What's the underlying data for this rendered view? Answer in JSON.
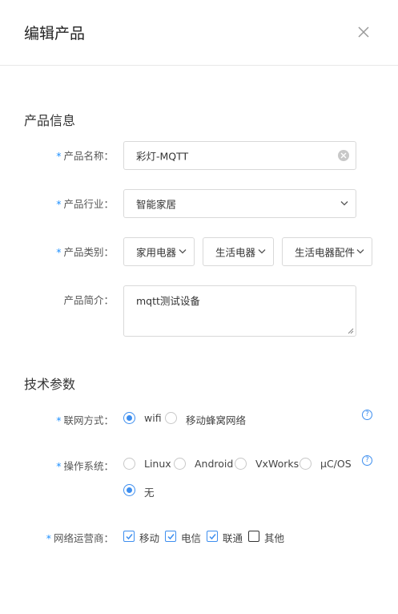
{
  "dialog": {
    "title": "编辑产品",
    "close_icon": "close-icon"
  },
  "product_info": {
    "section_title": "产品信息",
    "name": {
      "label": "产品名称：",
      "value": "彩灯-MQTT",
      "required": true
    },
    "industry": {
      "label": "产品行业：",
      "value": "智能家居",
      "required": true
    },
    "category": {
      "label": "产品类别：",
      "required": true,
      "level1": "家用电器",
      "level2": "生活电器",
      "level3": "生活电器配件"
    },
    "description": {
      "label": "产品简介：",
      "value": "mqtt测试设备",
      "required": false
    }
  },
  "tech_params": {
    "section_title": "技术参数",
    "network": {
      "label": "联网方式：",
      "required": true,
      "options": [
        "wifi",
        "移动蜂窝网络"
      ],
      "selected": "wifi",
      "help": "?"
    },
    "os": {
      "label": "操作系统：",
      "required": true,
      "options": [
        "Linux",
        "Android",
        "VxWorks",
        "μC/OS",
        "无"
      ],
      "selected": "无",
      "help": "?"
    },
    "carrier": {
      "label": "网络运营商：",
      "required": true,
      "options": [
        {
          "label": "移动",
          "checked": true
        },
        {
          "label": "电信",
          "checked": true
        },
        {
          "label": "联通",
          "checked": true
        },
        {
          "label": "其他",
          "checked": false
        }
      ]
    }
  },
  "colors": {
    "accent": "#3d8eef",
    "required_mark": "#1e90ff",
    "border": "#d9d9d9"
  }
}
